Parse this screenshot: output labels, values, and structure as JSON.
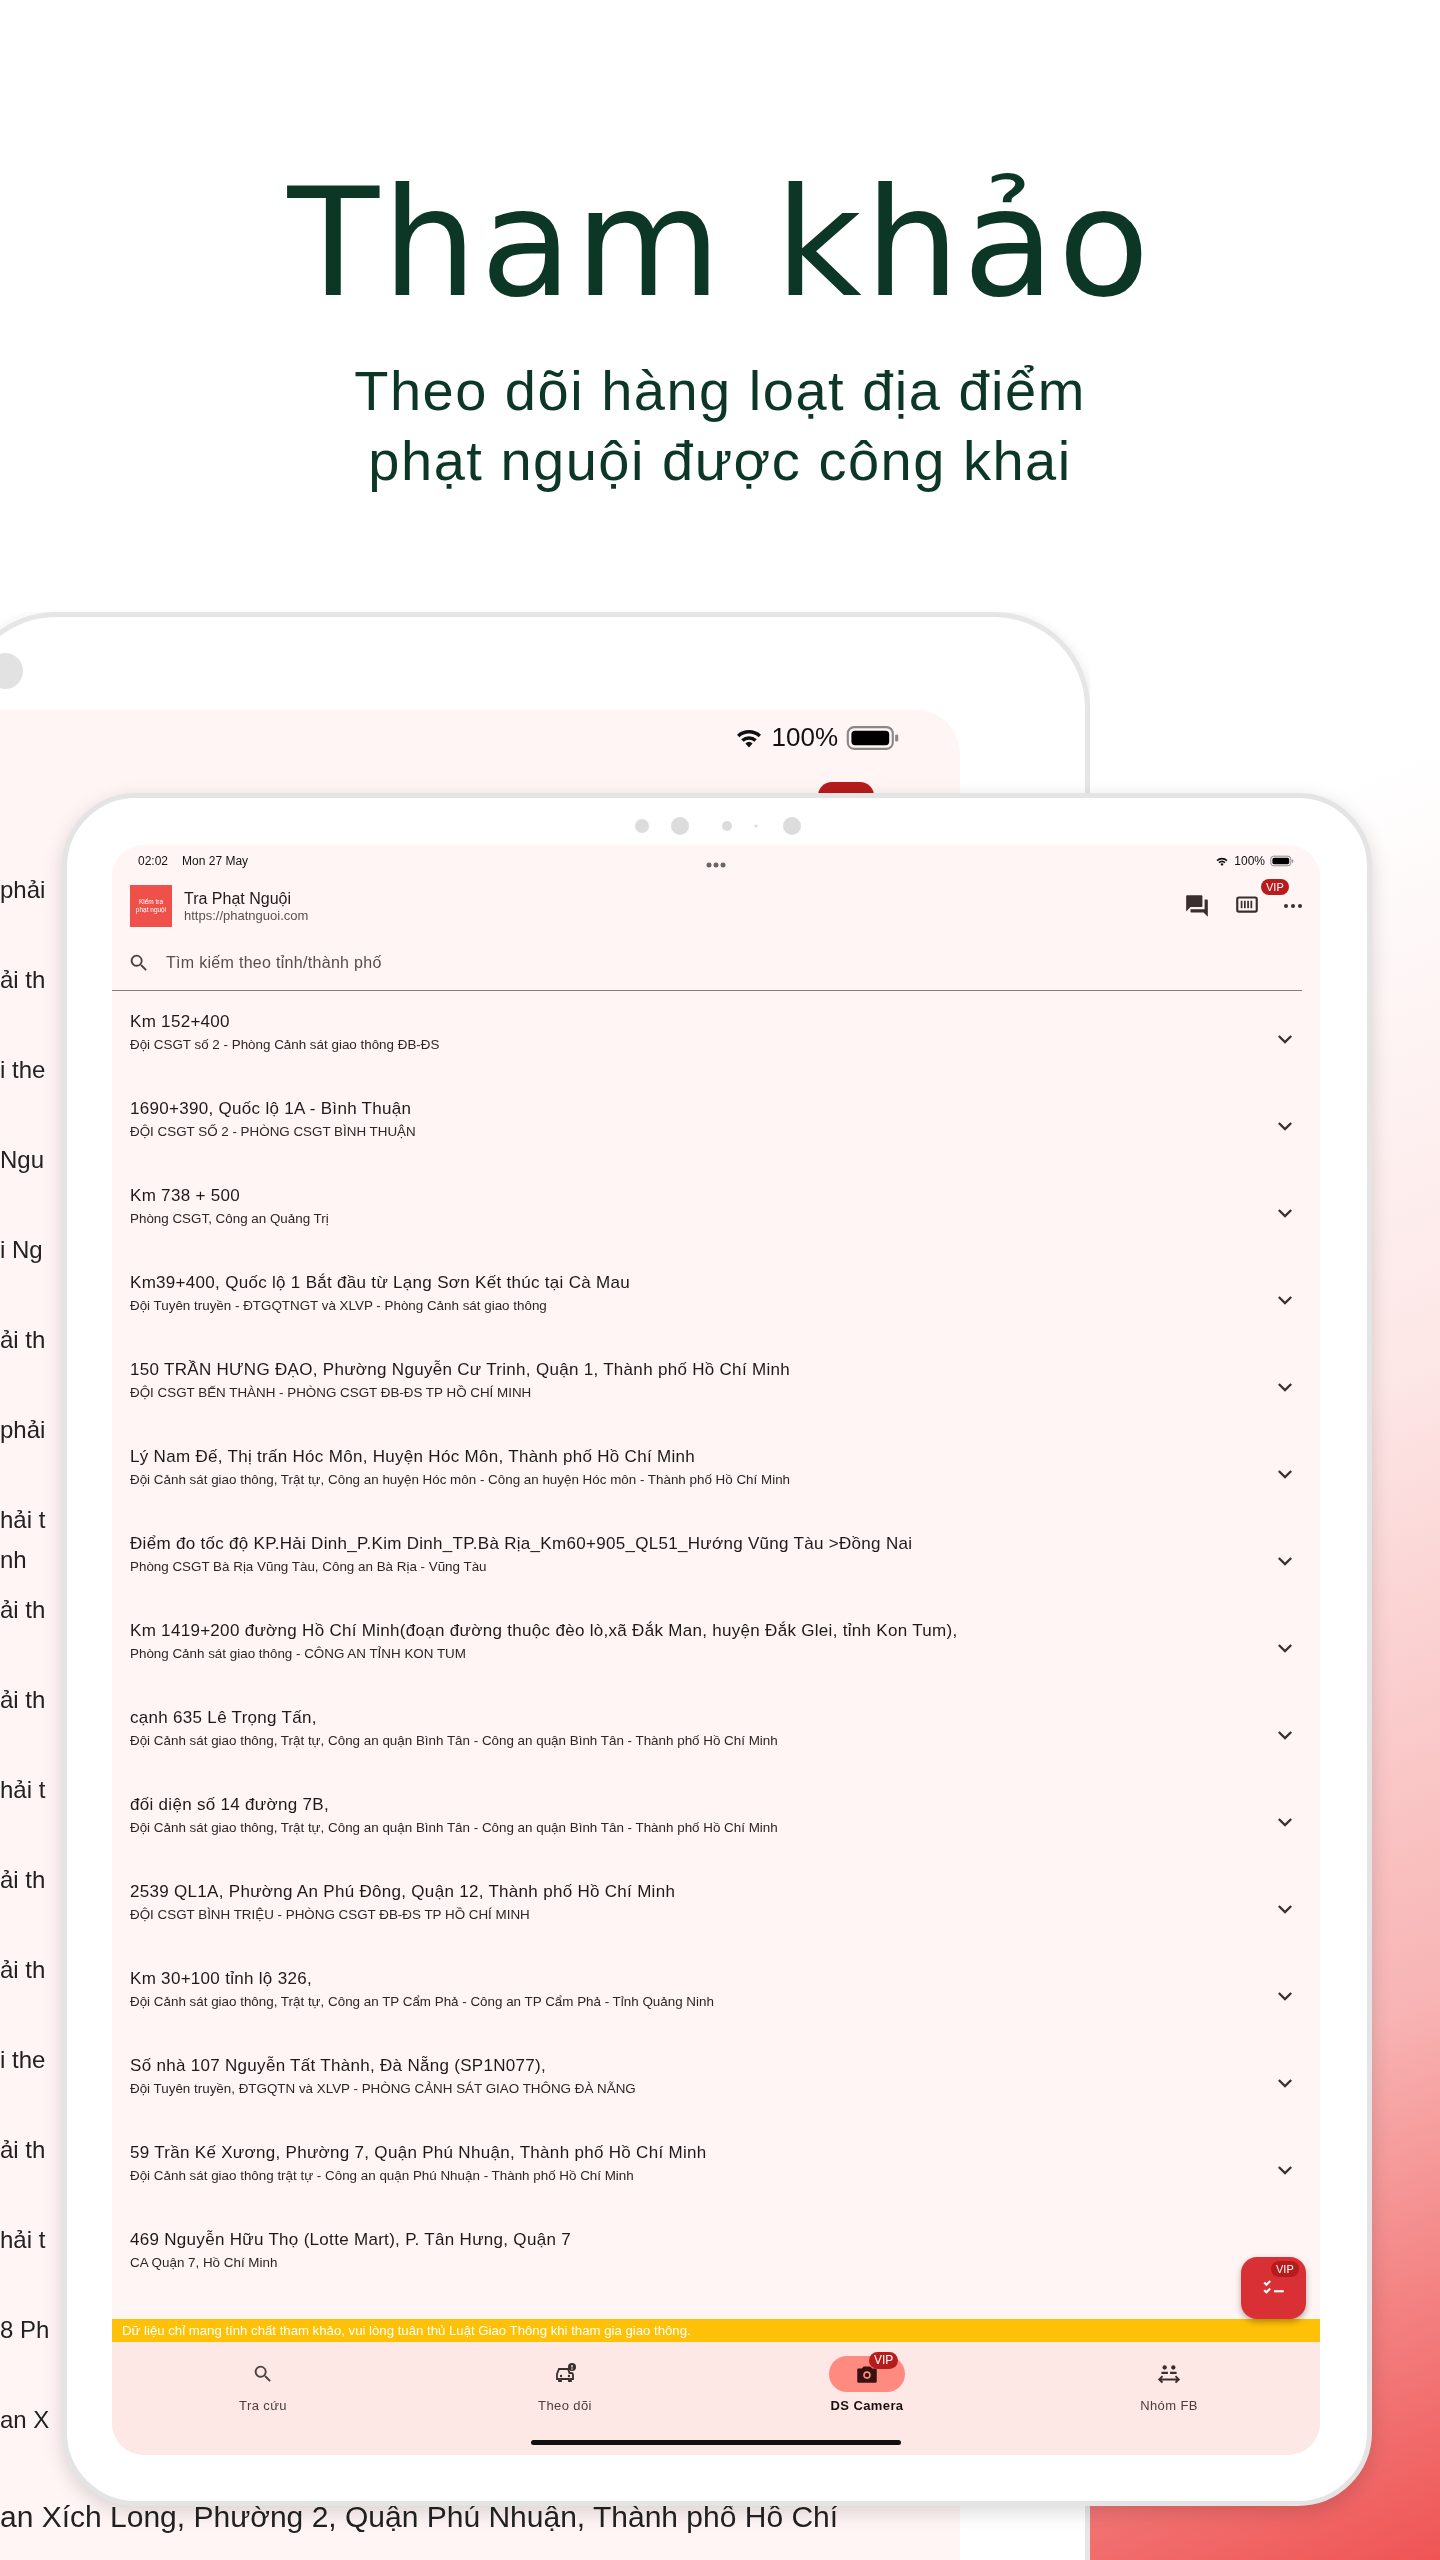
{
  "headline": {
    "title": "Tham khảo",
    "subtitle_lines": [
      "Theo dõi hàng loạt địa điểm",
      "phạt nguội được công khai"
    ]
  },
  "back_device": {
    "battery": "100%",
    "list_fragments": [
      "phải",
      "ải th",
      "i the",
      "Ngu",
      "i Ng",
      "ải th",
      "phải",
      "hải t\nnh",
      "ải th",
      "ải th",
      "hải t",
      "ải th",
      "ải th",
      "i the",
      "ải th",
      "hải t",
      "8 Ph",
      "an X"
    ],
    "bottom_fragment": "an Xích Long, Phường 2, Quận Phú Nhuận, Thành phố Hồ Chí"
  },
  "status_bar": {
    "time": "02:02",
    "date": "Mon 27 May",
    "battery": "100%"
  },
  "app_bar": {
    "logo_lines": [
      "Kiểm tra",
      "phạt nguội"
    ],
    "title": "Tra Phạt Nguội",
    "url": "https://phatnguoi.com",
    "vip_badge": "VIP"
  },
  "search": {
    "placeholder": "Tìm kiếm theo tỉnh/thành phố"
  },
  "locations": [
    {
      "address": "Km 152+400",
      "unit": "Đội CSGT số 2 - Phòng Cảnh sát giao thông ĐB-ĐS",
      "expandable": true
    },
    {
      "address": "1690+390, Quốc lộ 1A - Bình Thuận",
      "unit": "ĐỘI CSGT SỐ 2 - PHÒNG CSGT BÌNH THUẬN",
      "expandable": true
    },
    {
      "address": "Km 738 + 500",
      "unit": "Phòng CSGT, Công an  Quảng Trị",
      "expandable": true
    },
    {
      "address": "Km39+400, Quốc lộ 1 Bắt đầu từ Lạng Sơn Kết thúc tại Cà Mau",
      "unit": "Đội Tuyên truyền - ĐTGQTNGT và XLVP - Phòng Cảnh sát giao thông",
      "expandable": true
    },
    {
      "address": "150 TRẦN HƯNG ĐẠO, Phường Nguyễn Cư Trinh, Quận 1, Thành phố Hồ Chí Minh",
      "unit": "ĐỘI CSGT BẾN THÀNH - PHÒNG CSGT ĐB-ĐS TP HỒ CHÍ MINH",
      "expandable": true
    },
    {
      "address": "Lý Nam Đế, Thị trấn Hóc Môn, Huyện Hóc Môn, Thành phố Hồ Chí Minh",
      "unit": "Đội Cảnh sát giao thông, Trật tự, Công an huyện Hóc môn - Công an huyện Hóc môn - Thành phố Hồ Chí Minh",
      "expandable": true
    },
    {
      "address": "Điểm đo tốc độ KP.Hải Dinh_P.Kim Dinh_TP.Bà Rịa_Km60+905_QL51_Hướng Vũng Tàu >Đồng Nai",
      "unit": "Phòng CSGT Bà Rịa Vũng Tàu, Công an  Bà Rịa - Vũng Tàu",
      "expandable": true
    },
    {
      "address": "Km 1419+200 đường Hồ Chí Minh(đoạn đường thuộc đèo lò,xã Đắk Man, huyện Đắk Glei, tỉnh Kon Tum),",
      "unit": "Phòng Cảnh sát giao thông - CÔNG AN TỈNH KON TUM",
      "expandable": true
    },
    {
      "address": "cạnh 635 Lê Trọng Tấn,",
      "unit": "Đội Cảnh sát giao thông, Trật tự, Công an quận Bình Tân - Công an quận Bình Tân - Thành phố Hồ Chí Minh",
      "expandable": true
    },
    {
      "address": "đối diện số 14 đường 7B,",
      "unit": "Đội Cảnh sát giao thông, Trật tự, Công an quận Bình Tân - Công an quận Bình Tân - Thành phố Hồ Chí Minh",
      "expandable": true
    },
    {
      "address": "2539 QL1A, Phường An Phú Đông, Quận 12, Thành phố Hồ Chí Minh",
      "unit": "ĐỘI CSGT BÌNH TRIỆU - PHÒNG CSGT ĐB-ĐS TP HỒ CHÍ MINH",
      "expandable": true
    },
    {
      "address": "Km 30+100 tỉnh lộ 326,",
      "unit": "Đội Cảnh sát giao thông, Trật tự, Công an TP Cẩm Phả - Công an TP Cẩm Phả - Tỉnh Quảng Ninh",
      "expandable": true
    },
    {
      "address": "Số nhà 107 Nguyễn Tất Thành, Đà Nẵng (SP1N077),",
      "unit": "Đội Tuyên truyền, ĐTGQTN và XLVP - PHÒNG CẢNH SÁT GIAO THÔNG ĐÀ NẴNG",
      "expandable": true
    },
    {
      "address": "59 Trần Kế Xương, Phường 7, Quận Phú Nhuận, Thành phố Hồ Chí Minh",
      "unit": "Đội Cảnh sát giao thông trật tự - Công an quận Phú Nhuận - Thành phố Hồ Chí Minh",
      "expandable": true
    },
    {
      "address": "469 Nguyễn Hữu Thọ (Lotte Mart), P. Tân Hưng, Quận 7",
      "unit": "CA Quận 7,  Hồ Chí Minh",
      "expandable": false
    }
  ],
  "notice": "Dữ liệu chỉ mang tính chất tham khảo, vui lòng tuân thủ Luật Giao Thông khi tham gia giao thông.",
  "fab": {
    "badge": "VIP"
  },
  "nav": [
    {
      "kind": "search",
      "label": "Tra cứu",
      "selected": false
    },
    {
      "kind": "car",
      "label": "Theo dõi",
      "selected": false
    },
    {
      "kind": "camera",
      "label": "DS Camera",
      "selected": true,
      "badge": "VIP"
    },
    {
      "kind": "group",
      "label": "Nhóm FB",
      "selected": false
    }
  ]
}
